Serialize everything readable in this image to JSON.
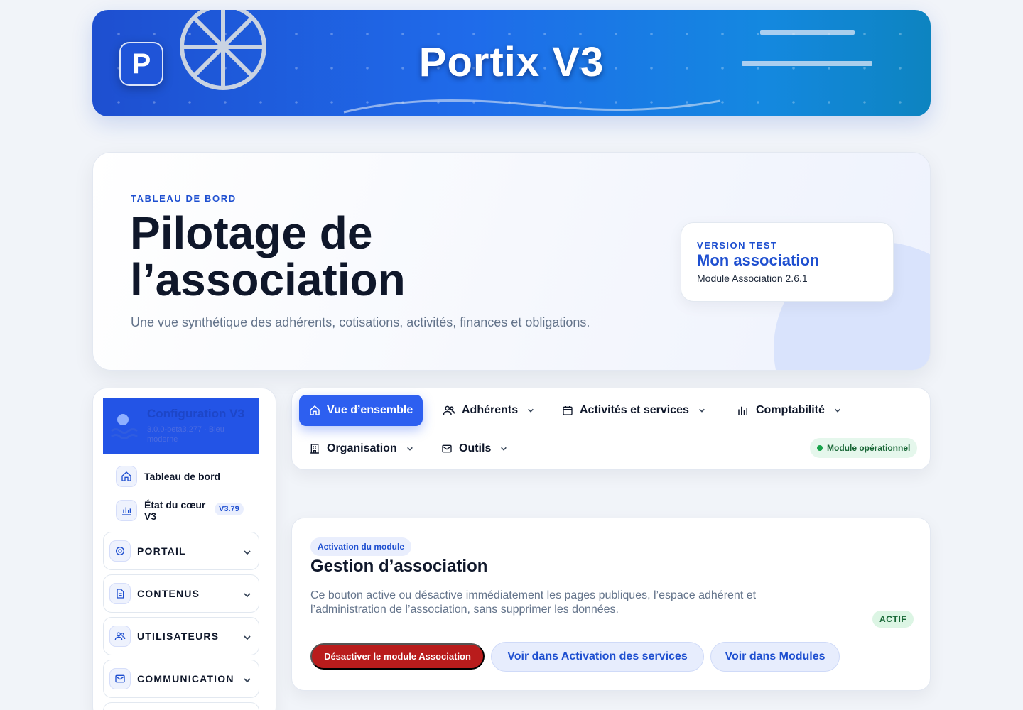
{
  "banner": {
    "logo_letter": "P",
    "title": "Portix V3"
  },
  "hero": {
    "eyebrow": "TABLEAU DE BORD",
    "title": "Pilotage de l’association",
    "subtitle": "Une vue synthétique des adhérents, cotisations, activités, finances et obligations.",
    "version_card": {
      "eyebrow": "VERSION TEST",
      "title": "Mon association",
      "subtitle": "Module Association 2.6.1"
    }
  },
  "sidebar": {
    "header": {
      "title": "Configuration V3",
      "subtitle": "3.0.0-beta3.277 · Bleu moderne"
    },
    "links": [
      {
        "label": "Tableau de bord",
        "icon": "home-icon"
      },
      {
        "label": "État du cœur V3",
        "icon": "bar-chart-icon",
        "badge": "V3.79"
      }
    ],
    "groups": [
      {
        "label": "PORTAIL",
        "icon": "settings-icon"
      },
      {
        "label": "CONTENUS",
        "icon": "document-icon"
      },
      {
        "label": "UTILISATEURS",
        "icon": "users-icon"
      },
      {
        "label": "COMMUNICATION",
        "icon": "mail-icon"
      }
    ]
  },
  "nav": {
    "items": [
      {
        "label": "Vue d’ensemble",
        "icon": "home-icon",
        "active": true
      },
      {
        "label": "Adhérents",
        "icon": "users-icon"
      },
      {
        "label": "Activités et services",
        "icon": "calendar-icon"
      },
      {
        "label": "Comptabilité",
        "icon": "bar-chart-icon"
      },
      {
        "label": "Organisation",
        "icon": "building-icon"
      },
      {
        "label": "Outils",
        "icon": "mail-icon"
      }
    ],
    "status": "Module opérationnel",
    "colors": {
      "active": "#2d5ff0",
      "status_dot": "#16a34a"
    }
  },
  "module": {
    "badge": "Activation du module",
    "title": "Gestion d’association",
    "description": "Ce bouton active ou désactive immédiatement les pages publiques, l’espace adhérent et l’administration de l’association, sans supprimer les données.",
    "status": "ACTIF",
    "buttons": {
      "deactivate": "Désactiver le module Association",
      "services": "Voir dans Activation des services",
      "modules": "Voir dans Modules"
    },
    "colors": {
      "danger": "#b91c1c",
      "accent": "#1e4fd0"
    }
  }
}
